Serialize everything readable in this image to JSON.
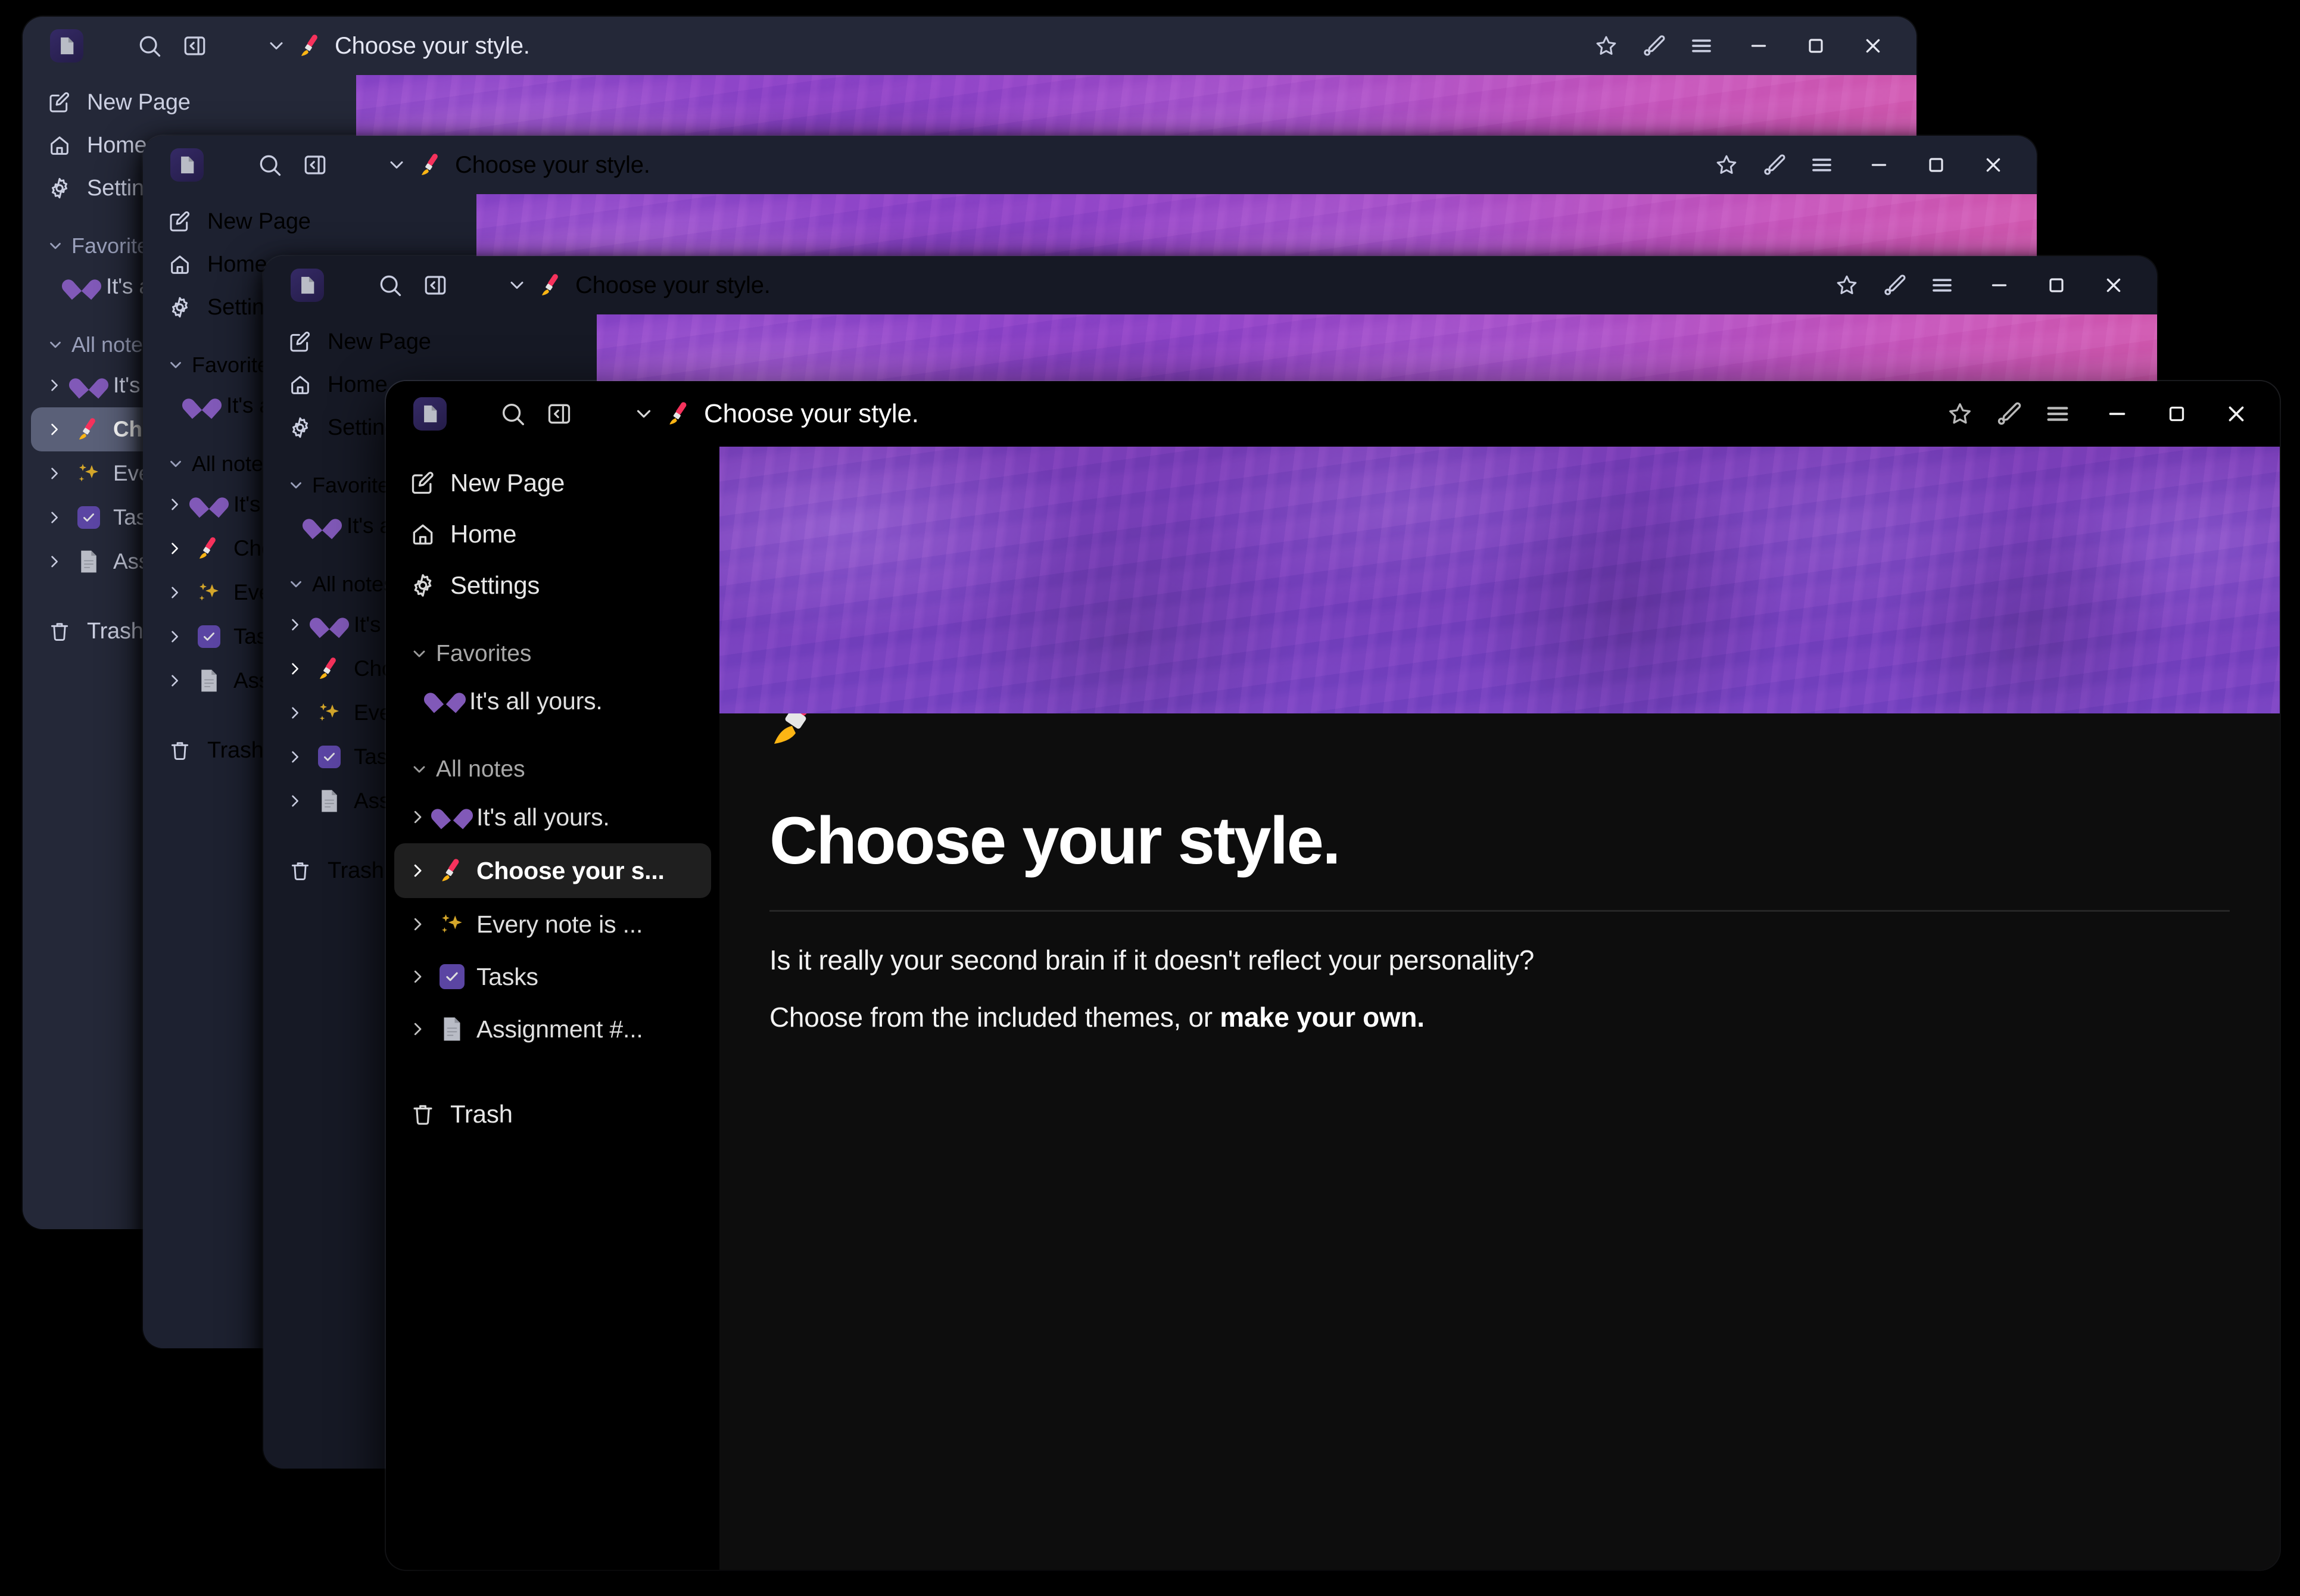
{
  "app": {
    "logo_icon": "document-icon",
    "accent_purple": "#7b41bd",
    "accent_indigo": "#2a2050",
    "window_bg_active": "#0d0d0d",
    "window_bg_inactive": "#242838"
  },
  "titlebar": {
    "search_icon": "search-icon",
    "sidebar_toggle_icon": "panel-collapse-left-icon",
    "breadcrumb_chevron_icon": "chevron-down-icon",
    "page_emoji": "paintbrush-emoji",
    "page_title": "Choose your style.",
    "actions": [
      {
        "name": "favorite-button",
        "icon": "star-icon"
      },
      {
        "name": "theme-button",
        "icon": "paintbrush-icon"
      },
      {
        "name": "menu-button",
        "icon": "hamburger-menu-icon"
      },
      {
        "name": "minimize-button",
        "icon": "minimize-icon"
      },
      {
        "name": "maximize-button",
        "icon": "maximize-icon"
      },
      {
        "name": "close-button",
        "icon": "close-icon"
      }
    ]
  },
  "sidebar": {
    "nav": [
      {
        "label": "New Page",
        "icon": "new-page-icon"
      },
      {
        "label": "Home",
        "icon": "home-icon"
      },
      {
        "label": "Settings",
        "icon": "gear-icon"
      }
    ],
    "favorites": {
      "label": "Favorites",
      "chevron_icon": "chevron-down-icon",
      "items": [
        {
          "label": "It's all yours.",
          "emoji": "purple-heart-emoji"
        }
      ]
    },
    "all_notes": {
      "label": "All notes",
      "chevron_icon": "chevron-down-icon",
      "items": [
        {
          "label": "It's all yours.",
          "emoji": "purple-heart-emoji",
          "chevron_icon": "chevron-right-icon",
          "active": false
        },
        {
          "label": "Choose your s...",
          "emoji": "paintbrush-emoji",
          "chevron_icon": "chevron-right-icon",
          "active": true
        },
        {
          "label": "Every note is ...",
          "emoji": "sparkles-emoji",
          "chevron_icon": "chevron-right-icon",
          "active": false
        },
        {
          "label": "Tasks",
          "emoji": "checkbox-emoji",
          "chevron_icon": "chevron-right-icon",
          "active": false
        },
        {
          "label": "Assignment #...",
          "emoji": "page-emoji",
          "chevron_icon": "chevron-right-icon",
          "active": false
        }
      ]
    },
    "trash": {
      "label": "Trash",
      "icon": "trash-icon"
    }
  },
  "document": {
    "cover_image": "purple-smoke-banner",
    "emoji": "paintbrush-emoji",
    "heading": "Choose your style.",
    "paragraph_1": "Is it really your second brain if it doesn't reflect your personality?",
    "paragraph_2_prefix": "Choose from the included themes, or ",
    "paragraph_2_bold": "make your own."
  }
}
